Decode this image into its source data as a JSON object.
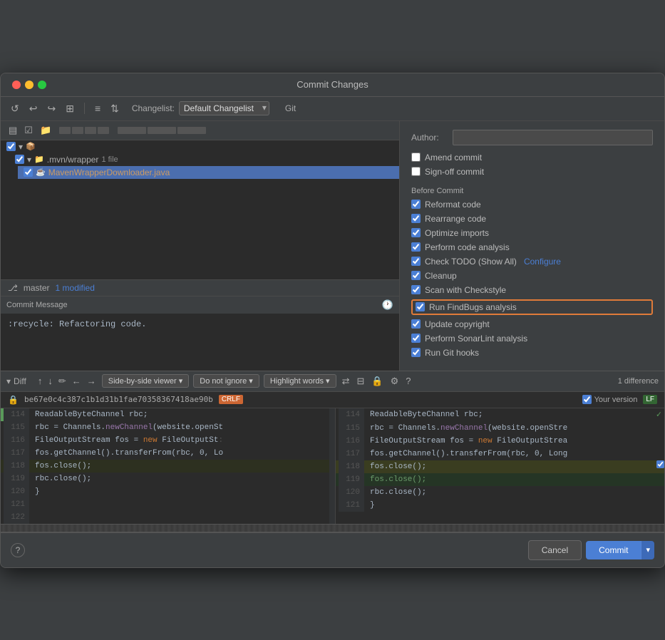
{
  "dialog": {
    "title": "Commit Changes"
  },
  "toolbar": {
    "changelist_label": "Changelist:",
    "changelist_value": "Default Changelist",
    "git_label": "Git"
  },
  "filetree": {
    "root_checkbox": true,
    "mvn_wrapper": ".mvn/wrapper",
    "mvn_file_count": "1 file",
    "file_name": "MavenWrapperDownloader.java"
  },
  "statusbar": {
    "branch": "master",
    "modified": "1 modified"
  },
  "commit_message": {
    "label": "Commit Message",
    "value": ":recycle: Refactoring code."
  },
  "git_panel": {
    "author_label": "Author:",
    "author_placeholder": "",
    "amend_commit": "Amend commit",
    "sign_off": "Sign-off commit",
    "before_commit_header": "Before Commit",
    "options": [
      {
        "label": "Reformat code",
        "checked": true
      },
      {
        "label": "Rearrange code",
        "checked": true
      },
      {
        "label": "Optimize imports",
        "checked": true
      },
      {
        "label": "Perform code analysis",
        "checked": true
      },
      {
        "label": "Check TODO (Show All)",
        "checked": true,
        "has_configure": true
      },
      {
        "label": "Cleanup",
        "checked": true
      },
      {
        "label": "Scan with Checkstyle",
        "checked": true
      },
      {
        "label": "Run FindBugs analysis",
        "checked": true,
        "highlighted": true
      },
      {
        "label": "Update copyright",
        "checked": true
      },
      {
        "label": "Perform SonarLint analysis",
        "checked": true
      },
      {
        "label": "Run Git hooks",
        "checked": true
      }
    ],
    "configure_label": "Configure"
  },
  "diff": {
    "section_label": "Diff",
    "viewer_label": "Side-by-side viewer",
    "ignore_label": "Do not ignore",
    "highlight_label": "Highlight words",
    "difference_count": "1 difference",
    "left_hash": "be67e0c4c387c1b1d31b1fae70358367418ae90b",
    "left_encoding": "CRLF",
    "right_label": "Your version",
    "right_encoding": "LF",
    "lines": [
      {
        "num_l": "114",
        "num_r": "114",
        "code_l": "ReadableByteChannel rbc;",
        "code_r": "ReadableByteChannel rbc;",
        "type": "normal",
        "left_mark": true
      },
      {
        "num_l": "115",
        "num_r": "115",
        "code_l": "rbc = Channels.newChannel(website.openSt",
        "code_r": "rbc = Channels.newChannel(website.openStre",
        "type": "normal"
      },
      {
        "num_l": "116",
        "num_r": "116",
        "code_l": "FileOutputStream fos = new FileOutputSt:",
        "code_r": "FileOutputStream fos = new FileOutputStrea",
        "type": "normal"
      },
      {
        "num_l": "117",
        "num_r": "117",
        "code_l": "fos.getChannel().transferFrom(rbc, 0, Lo",
        "code_r": "fos.getChannel().transferFrom(rbc, 0, Long",
        "type": "normal"
      },
      {
        "num_l": "118",
        "num_r": "118",
        "code_l": "fos.close();",
        "code_r": "fos.close();",
        "type": "changed",
        "right_mark": true
      },
      {
        "num_l": "119",
        "num_r": "119",
        "code_l": "",
        "code_r": "fos.close();",
        "type": "added"
      },
      {
        "num_l": "120",
        "num_r": "120",
        "code_l": "rbc.close();",
        "code_r": "rbc.close();",
        "type": "normal"
      },
      {
        "num_l": "121",
        "num_r": "121",
        "code_l": "}",
        "code_r": "}",
        "type": "normal"
      },
      {
        "num_l": "122",
        "num_r": "",
        "code_l": "",
        "code_r": "",
        "type": "empty"
      }
    ]
  },
  "bottom": {
    "help": "?",
    "cancel": "Cancel",
    "commit": "Commit"
  }
}
